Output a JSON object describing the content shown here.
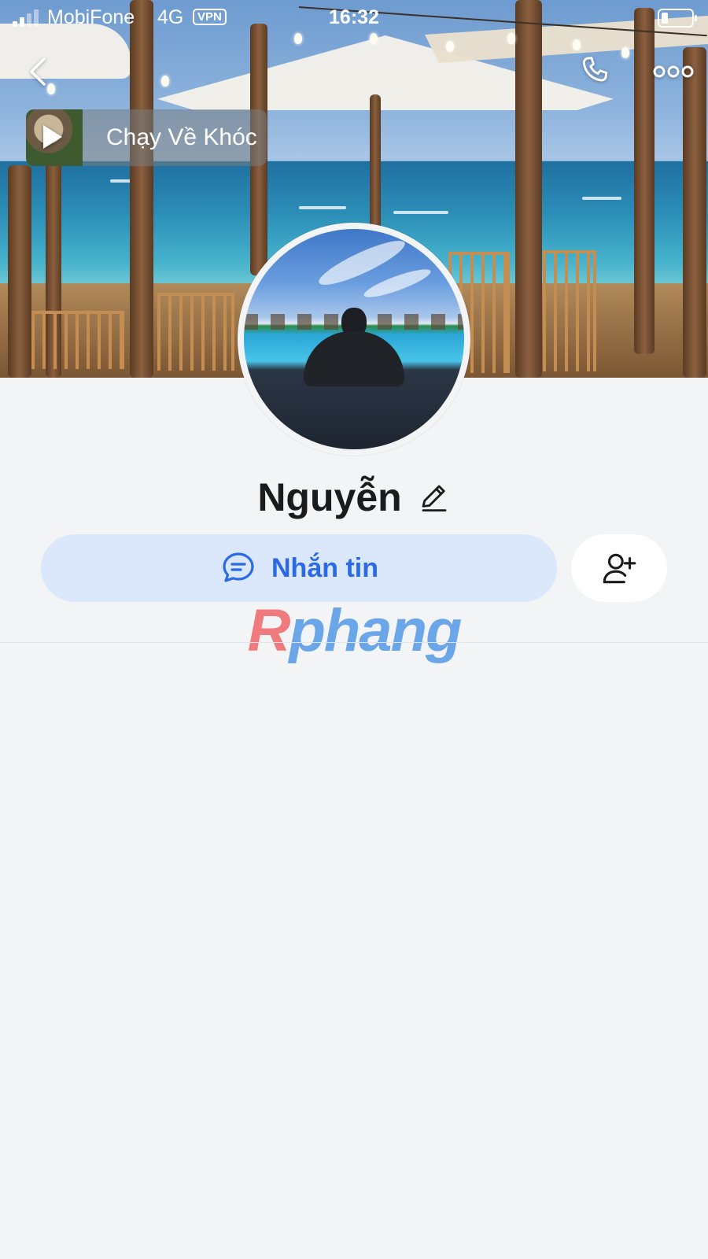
{
  "status_bar": {
    "carrier": "MobiFone",
    "network": "4G",
    "vpn": "VPN",
    "time": "16:32"
  },
  "nav": {
    "back_icon": "chevron-left-icon",
    "call_icon": "phone-icon",
    "more_icon": "more-dots-icon"
  },
  "music": {
    "title": "Chạy Về Khóc"
  },
  "profile": {
    "name": "Nguyễn"
  },
  "actions": {
    "message_label": "Nhắn tin",
    "add_friend_icon": "add-user-icon"
  },
  "watermark": {
    "part1": "R",
    "part2": "phang"
  },
  "colors": {
    "accent": "#2a6ae6",
    "message_bg": "#dbe7fb",
    "page_bg": "#f3f4f6"
  }
}
